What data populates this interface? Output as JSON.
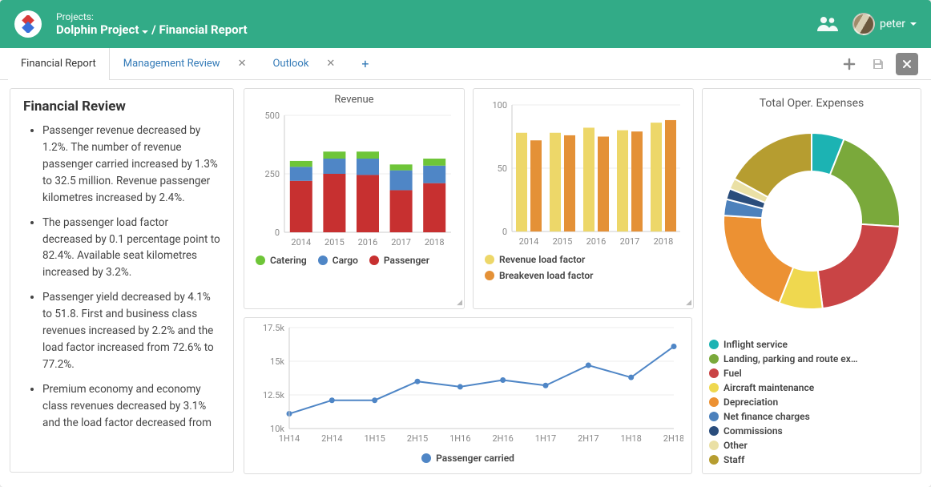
{
  "header": {
    "projects_label": "Projects:",
    "project_name": "Dolphin Project",
    "page_title": "Financial Report",
    "username": "peter"
  },
  "tabs": {
    "active": "Financial Report",
    "items": [
      "Financial Report",
      "Management Review",
      "Outlook"
    ]
  },
  "review": {
    "heading": "Financial Review",
    "bullets": [
      "Passenger revenue decreased by 1.2%. The number of revenue passenger carried increased by 1.3% to 32.5 million. Revenue passenger kilometres increased by 2.4%.",
      "The passenger load factor decreased by 0.1 percentage point to 82.4%. Available seat kilometres increased by 3.2%.",
      "Passenger yield decreased by 4.1% to 51.8. First and business class revenues increased by 2.2% and the load factor increased from 72.6% to 77.2%.",
      "Premium economy and economy class revenues decreased by 3.1% and the load factor decreased from"
    ]
  },
  "chart_data": [
    {
      "id": "revenue",
      "type": "bar",
      "stacked": true,
      "title": "Revenue",
      "categories": [
        "2014",
        "2015",
        "2016",
        "2017",
        "2018"
      ],
      "series": [
        {
          "name": "Passenger",
          "color": "#c73030",
          "values": [
            220,
            250,
            245,
            180,
            210
          ]
        },
        {
          "name": "Cargo",
          "color": "#4f86c6",
          "values": [
            60,
            65,
            70,
            85,
            75
          ]
        },
        {
          "name": "Catering",
          "color": "#6ec538",
          "values": [
            25,
            30,
            30,
            25,
            30
          ]
        }
      ],
      "ylabel": "",
      "ylim": [
        0,
        500
      ],
      "yticks": [
        0,
        250,
        500
      ]
    },
    {
      "id": "load_factor",
      "type": "bar",
      "stacked": false,
      "title": "",
      "categories": [
        "2014",
        "2015",
        "2016",
        "2017",
        "2018"
      ],
      "series": [
        {
          "name": "Revenue load factor",
          "color": "#edd769",
          "values": [
            78,
            78,
            82,
            80,
            86
          ]
        },
        {
          "name": "Breakeven load factor",
          "color": "#e49137",
          "values": [
            72,
            76,
            75,
            79,
            88
          ]
        }
      ],
      "ylabel": "",
      "ylim": [
        0,
        100
      ],
      "yticks": [
        0,
        50,
        100
      ]
    },
    {
      "id": "passenger_carried",
      "type": "line",
      "title": "",
      "x": [
        "1H14",
        "2H14",
        "1H15",
        "2H15",
        "1H16",
        "2H16",
        "1H17",
        "2H17",
        "1H18",
        "2H18"
      ],
      "series": [
        {
          "name": "Passenger carried",
          "color": "#4f86c6",
          "values": [
            11100,
            12100,
            12100,
            13500,
            13100,
            13600,
            13200,
            14700,
            13800,
            16100
          ]
        }
      ],
      "ylim": [
        10000,
        17500
      ],
      "yticks": [
        10000,
        12500,
        15000,
        17500
      ],
      "ytick_labels": [
        "10k",
        "12.5k",
        "15k",
        "17.5k"
      ]
    },
    {
      "id": "expenses",
      "type": "pie",
      "donut": true,
      "title": "Total Oper. Expenses",
      "slices": [
        {
          "name": "Inflight service",
          "color": "#1cb3b3",
          "value": 6
        },
        {
          "name": "Landing, parking and route ex…",
          "color": "#7aa93b",
          "value": 20
        },
        {
          "name": "Fuel",
          "color": "#c94445",
          "value": 22
        },
        {
          "name": "Aircraft maintenance",
          "color": "#efd84f",
          "value": 8
        },
        {
          "name": "Depreciation",
          "color": "#ec9133",
          "value": 20
        },
        {
          "name": "Net finance charges",
          "color": "#4c81bc",
          "value": 3
        },
        {
          "name": "Commissions",
          "color": "#2a4d7c",
          "value": 2
        },
        {
          "name": "Other",
          "color": "#eae0a5",
          "value": 2
        },
        {
          "name": "Staff",
          "color": "#b69d30",
          "value": 17
        }
      ]
    }
  ]
}
